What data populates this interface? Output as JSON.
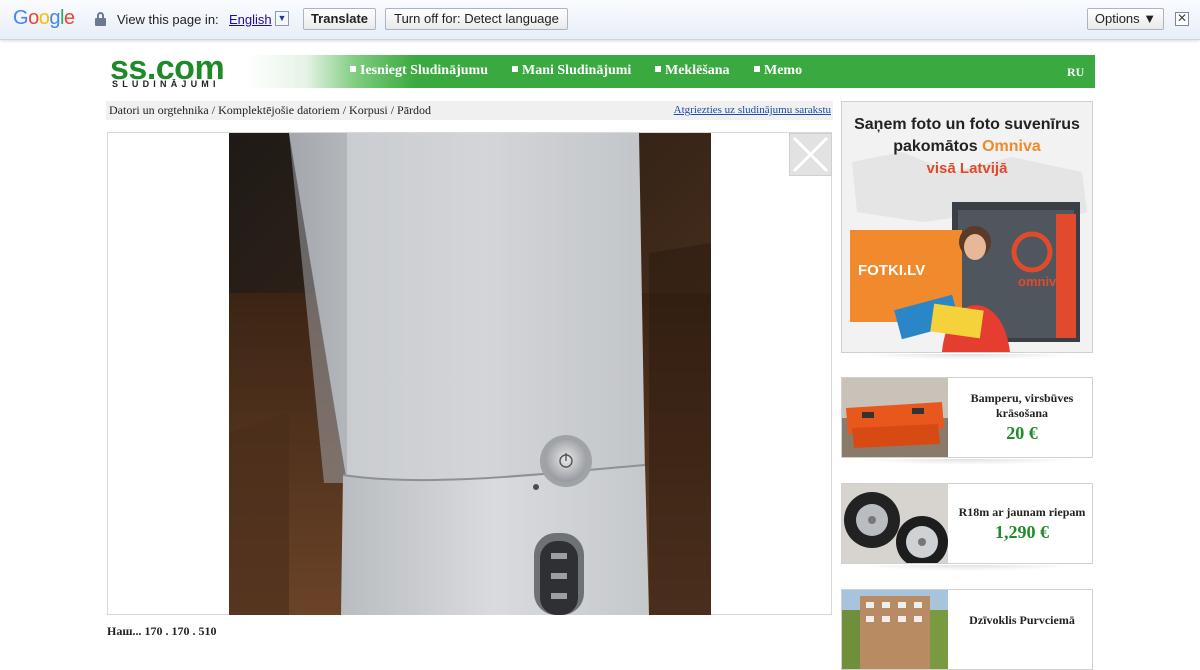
{
  "translate_bar": {
    "logo": [
      "G",
      "o",
      "o",
      "g",
      "l",
      "e"
    ],
    "logo_colors": [
      "#4285f4",
      "#ea4335",
      "#fbbc05",
      "#4285f4",
      "#34a853",
      "#ea4335"
    ],
    "view_text": "View this page in:",
    "language": "English",
    "language_dropdown_glyph": "▼",
    "translate_label": "Translate",
    "turnoff_label": "Turn off for: Detect language",
    "options_label": "Options ▼",
    "close_glyph": "✕"
  },
  "header": {
    "logo_text": "ss.com",
    "logo_sub": "SLUDINĀJUMI",
    "nav": [
      "Iesniegt Sludinājumu",
      "Mani Sludinājumi",
      "Meklēšana",
      "Memo"
    ],
    "lang_switch": "RU",
    "accent_color": "#3aa93f"
  },
  "breadcrumb": {
    "path": "Datori un orgtehnika / Komplektējošie datoriem / Korpusi / Pārdod",
    "back_link": "Atgriezties uz sludinājumu sarakstu"
  },
  "listing": {
    "image_alt_icon": "close-icon",
    "bottom_partial": "Наш... 170 . 170 . 510"
  },
  "sidebar": {
    "banner": {
      "headline_line1": "Saņem foto un foto suvenīrus",
      "headline_line2": "pakomātos",
      "brand": "Omniva",
      "headline_line3": "visā Latvijā",
      "left_brand": "FOTKI.LV",
      "right_brand": "omniva"
    },
    "ads": [
      {
        "title": "Bamperu, virsbūves krāsošana",
        "price": "20 €"
      },
      {
        "title": "R18m ar jaunam riepam",
        "price": "1,290 €"
      },
      {
        "title": "Dzīvoklis Purvciemā",
        "price": ""
      }
    ]
  }
}
